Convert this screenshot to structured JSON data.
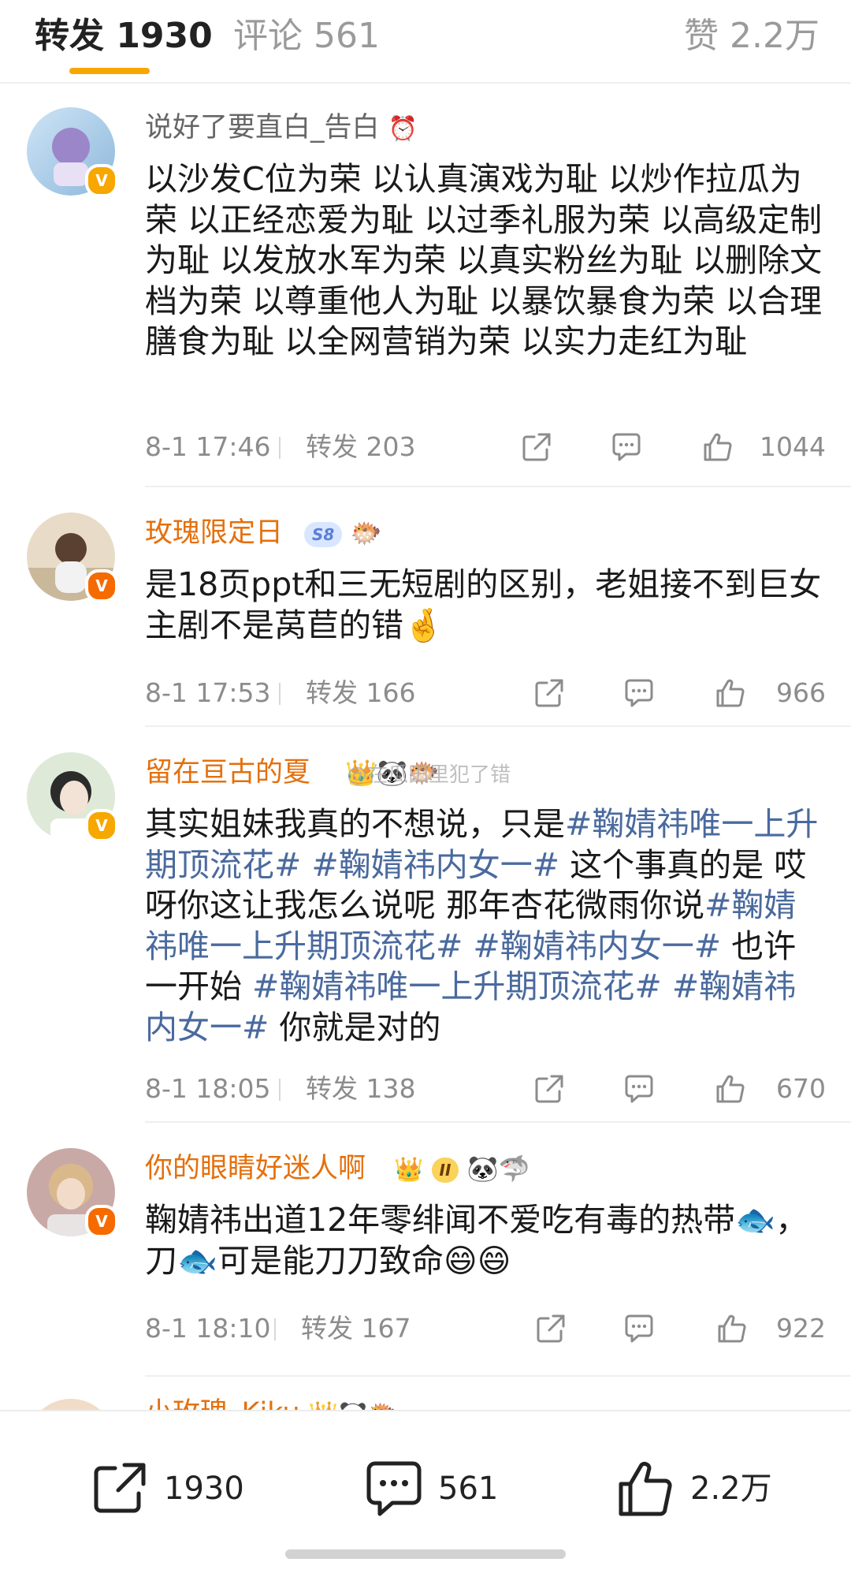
{
  "tabs": {
    "repost": "转发 1930",
    "comment": "评论 561",
    "like": "赞 2.2万"
  },
  "watermark": "@在瓜田里犯了错",
  "items": [
    {
      "name": "说好了要直白_告白",
      "name_emojis": "⏰",
      "content_segments": [
        {
          "text": "以沙发C位为荣 以认真演戏为耻 以炒作拉瓜为荣 以正经恋爱为耻 以过季礼服为荣 以高级定制为耻 以发放水军为荣 以真实粉丝为耻 以删除文档为荣 以尊重他人为耻 以暴饮暴食为荣 以合理膳食为耻 以全网营销为荣 以实力走红为耻",
          "hashtag": false
        }
      ],
      "time": "8-1 17:46",
      "repost": "转发 203",
      "likes": "1044"
    },
    {
      "name": "玫瑰限定日",
      "badge": "S8",
      "name_emojis": "🐡",
      "content_segments": [
        {
          "text": "是18页ppt和三无短剧的区别，老姐接不到巨女主剧不是莴苣的错🤞",
          "hashtag": false
        }
      ],
      "time": "8-1 17:53",
      "repost": "转发 166",
      "likes": "966"
    },
    {
      "name": "留在亘古的夏",
      "name_emojis": "👑🐼🐡",
      "content_segments": [
        {
          "text": "其实姐妹我真的不想说，只是",
          "hashtag": false
        },
        {
          "text": "#鞠婧祎唯一上升期顶流花#",
          "hashtag": true
        },
        {
          "text": " ",
          "hashtag": false
        },
        {
          "text": "#鞠婧祎内女一#",
          "hashtag": true
        },
        {
          "text": " 这个事真的是 哎呀你这让我怎么说呢 那年杏花微雨你说",
          "hashtag": false
        },
        {
          "text": "#鞠婧祎唯一上升期顶流花#",
          "hashtag": true
        },
        {
          "text": " ",
          "hashtag": false
        },
        {
          "text": "#鞠婧祎内女一#",
          "hashtag": true
        },
        {
          "text": " 也许一开始 ",
          "hashtag": false
        },
        {
          "text": "#鞠婧祎唯一上升期顶流花#",
          "hashtag": true
        },
        {
          "text": " ",
          "hashtag": false
        },
        {
          "text": "#鞠婧祎内女一#",
          "hashtag": true
        },
        {
          "text": " 你就是对的",
          "hashtag": false
        }
      ],
      "time": "8-1 18:05",
      "repost": "转发 138",
      "likes": "670"
    },
    {
      "name": "你的眼睛好迷人啊",
      "badge": "II",
      "name_emojis": "🐼🦈",
      "content_segments": [
        {
          "text": "鞠婧祎出道12年零绯闻不爱吃有毒的热带🐟，刀🐟可是能刀刀致命😄😄",
          "hashtag": false
        }
      ],
      "time": "8-1 18:10",
      "repost": "转发 167",
      "likes": "922"
    },
    {
      "name": "小玫瑰_Kiku",
      "name_emojis": "👑🐼🐡",
      "content_segments": [],
      "time": "",
      "repost": "",
      "likes": ""
    }
  ],
  "bottom_bar": {
    "repost": "1930",
    "comment": "561",
    "like": "2.2万"
  }
}
